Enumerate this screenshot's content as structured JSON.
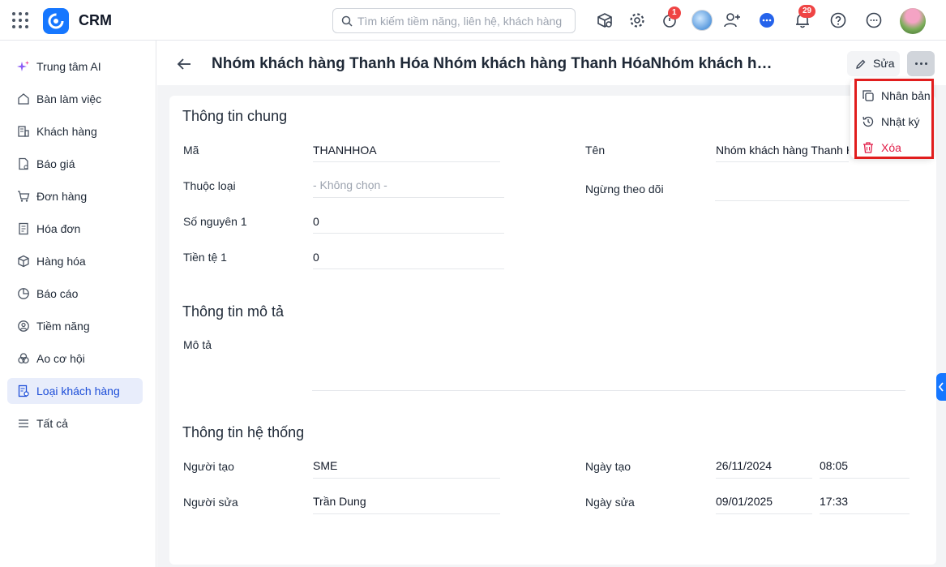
{
  "app": {
    "brand": "CRM"
  },
  "search": {
    "placeholder": "Tìm kiếm tiềm năng, liên hệ, khách hàng"
  },
  "topbar": {
    "timer_badge": "1",
    "notification_badge": "29"
  },
  "sidebar": {
    "items": [
      {
        "label": "Trung tâm AI",
        "icon": "sparkle-icon"
      },
      {
        "label": "Bàn làm việc",
        "icon": "home-icon"
      },
      {
        "label": "Khách hàng",
        "icon": "building-icon"
      },
      {
        "label": "Báo giá",
        "icon": "quote-doc-icon"
      },
      {
        "label": "Đơn hàng",
        "icon": "cart-icon"
      },
      {
        "label": "Hóa đơn",
        "icon": "invoice-icon"
      },
      {
        "label": "Hàng hóa",
        "icon": "box-icon"
      },
      {
        "label": "Báo cáo",
        "icon": "pie-chart-icon"
      },
      {
        "label": "Tiềm năng",
        "icon": "target-user-icon"
      },
      {
        "label": "Ao cơ hội",
        "icon": "circles-icon"
      },
      {
        "label": "Loại khách hàng",
        "icon": "customer-type-icon",
        "active": true
      },
      {
        "label": "Tất cả",
        "icon": "list-icon"
      }
    ]
  },
  "header": {
    "title": "Nhóm khách hàng Thanh Hóa Nhóm khách hàng Thanh HóaNhóm khách hàng ...",
    "edit_label": "Sửa"
  },
  "dropdown": {
    "items": [
      {
        "label": "Nhân bản",
        "icon": "copy-icon"
      },
      {
        "label": "Nhật ký",
        "icon": "history-icon"
      },
      {
        "label": "Xóa",
        "icon": "trash-icon",
        "color": "#e11d48"
      }
    ]
  },
  "general": {
    "title": "Thông tin chung",
    "ma_label": "Mã",
    "ma_value": "THANHHOA",
    "ten_label": "Tên",
    "ten_value": "Nhóm khách hàng Thanh Hóa",
    "thuoc_loai_label": "Thuộc loại",
    "thuoc_loai_placeholder": "- Không chọn -",
    "ngung_label": "Ngừng theo dõi",
    "so_nguyen_label": "Số nguyên 1",
    "so_nguyen_value": "0",
    "tien_te_label": "Tiền tệ 1",
    "tien_te_value": "0"
  },
  "description": {
    "title": "Thông tin mô tả",
    "mo_ta_label": "Mô tả"
  },
  "system": {
    "title": "Thông tin hệ thống",
    "nguoi_tao_label": "Người tạo",
    "nguoi_tao_value": "SME",
    "ngay_tao_label": "Ngày tạo",
    "ngay_tao_date": "26/11/2024",
    "ngay_tao_time": "08:05",
    "nguoi_sua_label": "Người sửa",
    "nguoi_sua_value": "Trần Dung",
    "ngay_sua_label": "Ngày sửa",
    "ngay_sua_date": "09/01/2025",
    "ngay_sua_time": "17:33"
  },
  "colors": {
    "accent": "#1677ff",
    "active_bg": "#e8edfb",
    "danger": "#e11d48",
    "highlight_border": "#e11d1d"
  }
}
